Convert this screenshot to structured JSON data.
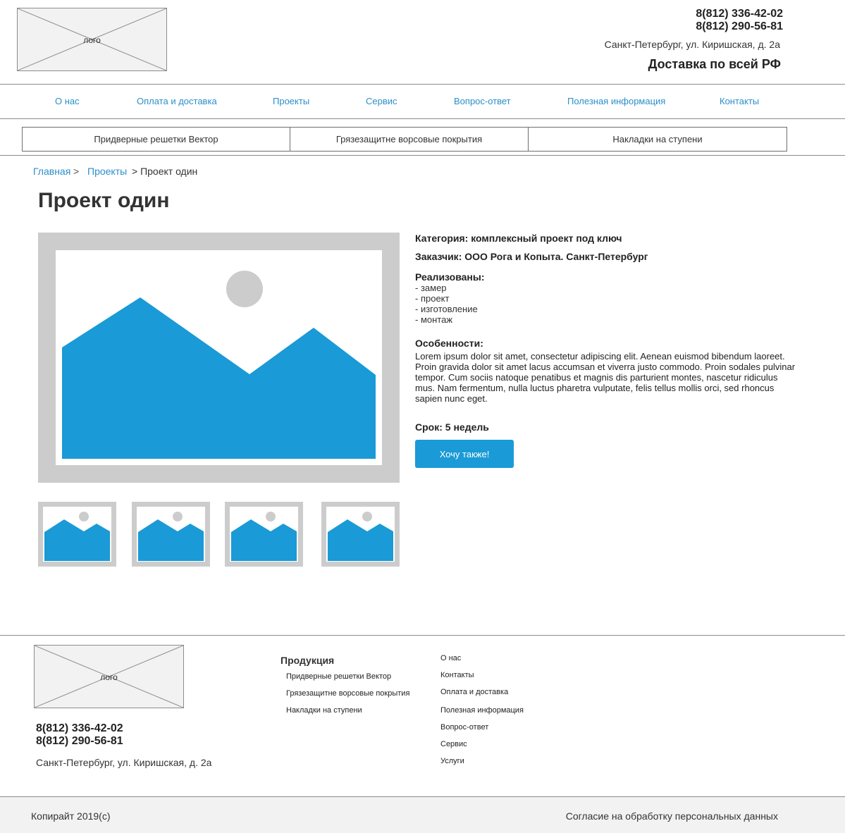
{
  "header": {
    "logo_text": "лого",
    "phone1": "8(812) 336-42-02",
    "phone2": "8(812) 290-56-81",
    "address": "Санкт-Петербург, ул. Киришская, д. 2а",
    "delivery": "Доставка по всей РФ"
  },
  "nav": {
    "items": [
      {
        "label": "О нас"
      },
      {
        "label": "Оплата и доставка"
      },
      {
        "label": "Проекты"
      },
      {
        "label": "Сервис"
      },
      {
        "label": "Вопрос-ответ"
      },
      {
        "label": "Полезная информация"
      },
      {
        "label": "Контакты"
      }
    ]
  },
  "categories": {
    "items": [
      {
        "label": "Придверные решетки Вектор"
      },
      {
        "label": "Грязезащитне ворсовые покрытия"
      },
      {
        "label": "Накладки на ступени"
      }
    ]
  },
  "breadcrumb": {
    "home": "Главная",
    "projects": "Проекты",
    "sep": ">",
    "current": "> Проект один"
  },
  "page_title": "Проект один",
  "project": {
    "category": "Категория: комплексный проект под ключ",
    "customer": "Заказчик: ООО Рога и Копыта. Санкт-Петербург",
    "done_title": "Реализованы:",
    "done_items": [
      "- замер",
      "- проект",
      "- изготовление",
      "- монтаж"
    ],
    "features_title": "Особенности:",
    "features_text": "Lorem ipsum dolor sit amet, consectetur adipiscing elit. Aenean euismod bibendum laoreet. Proin gravida dolor sit amet lacus accumsan et viverra justo commodo. Proin sodales pulvinar tempor. Cum sociis natoque penatibus et magnis dis parturient montes, nascetur ridiculus mus. Nam fermentum, nulla luctus pharetra vulputate, felis tellus mollis orci, sed rhoncus sapien nunc eget.",
    "term": "Срок: 5 недель",
    "cta_label": "Хочу также!"
  },
  "footer": {
    "logo_text": "лого",
    "phone1": "8(812) 336-42-02",
    "phone2": "8(812) 290-56-81",
    "address": "Санкт-Петербург, ул. Киришская, д. 2а",
    "products_title": "Продукция",
    "products": [
      {
        "label": "Придверные решетки Вектор"
      },
      {
        "label": "Грязезащитне ворсовые покрытия"
      },
      {
        "label": "Накладки на ступени"
      }
    ],
    "links": [
      {
        "label": "О нас"
      },
      {
        "label": "Контакты"
      },
      {
        "label": "Оплата и доставка"
      },
      {
        "label": "Полезная информация"
      },
      {
        "label": "Вопрос-ответ"
      },
      {
        "label": "Сервис"
      },
      {
        "label": "Услуги"
      }
    ],
    "copyright": "Копирайт 2019(с)",
    "consent": "Согласие на обработку персональных данных"
  },
  "colors": {
    "accent": "#1a9ad6",
    "link": "#2a8fc9",
    "placeholder_gray": "#cccccc",
    "bottom_bar": "#f2f2f2"
  }
}
